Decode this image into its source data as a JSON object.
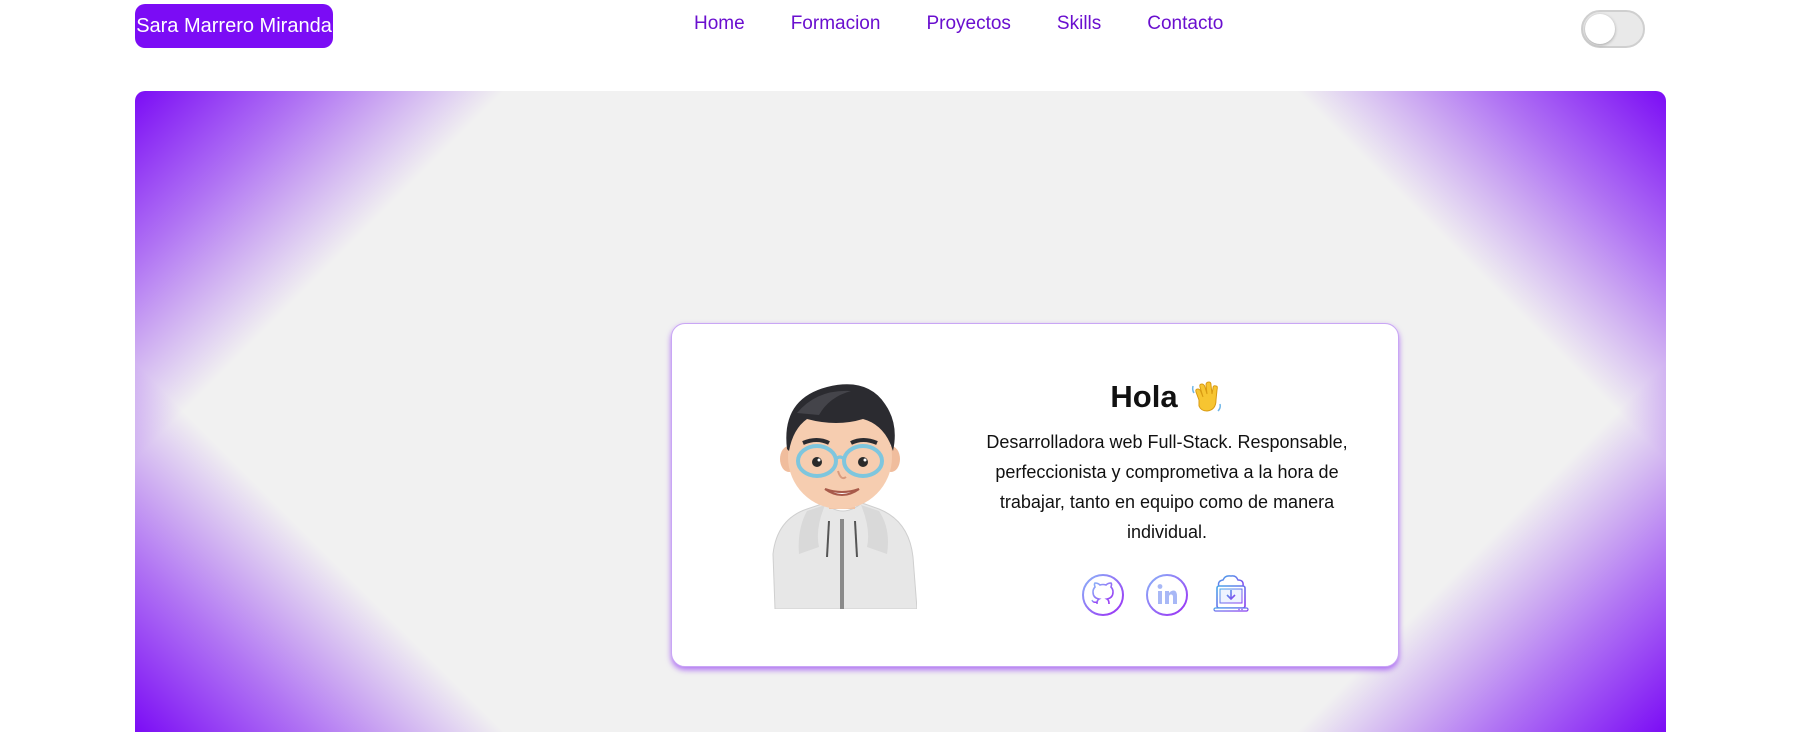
{
  "header": {
    "brand": "Sara Marrero Miranda",
    "nav": [
      {
        "label": "Home"
      },
      {
        "label": "Formacion"
      },
      {
        "label": "Proyectos"
      },
      {
        "label": "Skills"
      },
      {
        "label": "Contacto"
      }
    ],
    "theme_toggle": {
      "state": "off"
    }
  },
  "hero": {
    "greeting": "Hola",
    "greeting_icon": "waving-hand-icon",
    "description": "Desarrolladora web Full-Stack. Responsable, perfeccionista y comprometiva a la hora de trabajar, tanto en equipo como de manera individual.",
    "avatar_icon": "memoji-avatar",
    "socials": [
      {
        "icon": "github-icon"
      },
      {
        "icon": "linkedin-icon"
      },
      {
        "icon": "cv-download-icon"
      }
    ]
  },
  "colors": {
    "accent": "#7b0cf5",
    "nav_text": "#6a0fcf",
    "panel_bg": "#f1f1f1",
    "card_bg": "#ffffff"
  }
}
